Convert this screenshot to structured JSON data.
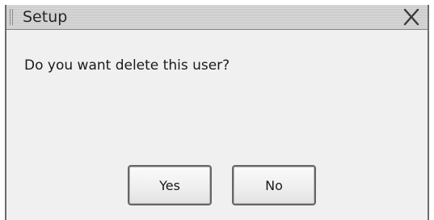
{
  "dialog": {
    "title": "Setup",
    "message": "Do you want delete this user?",
    "close_icon": "close-icon",
    "buttons": {
      "yes_label": "Yes",
      "no_label": "No"
    }
  }
}
